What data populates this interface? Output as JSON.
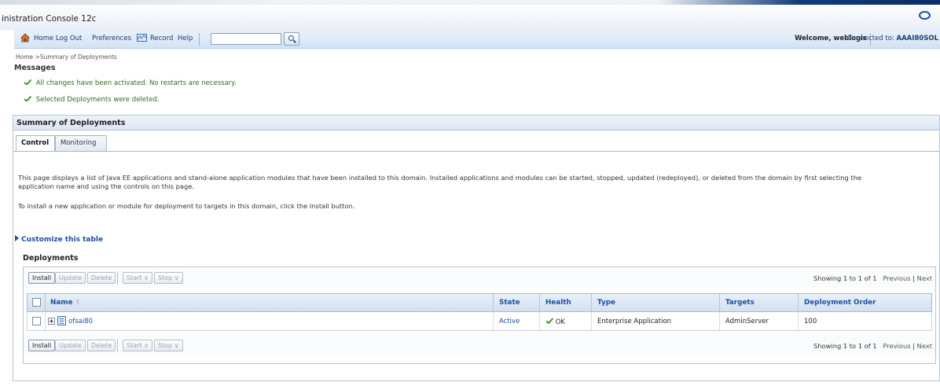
{
  "window": {
    "title": "inistration Console 12c"
  },
  "toolbar": {
    "home": "Home",
    "logout": "Log Out",
    "preferences": "Preferences",
    "record": "Record",
    "help": "Help",
    "search_value": "",
    "welcome": "Welcome, weblogic",
    "connected_prefix": "Connected to:",
    "connected_domain": "AAAI80SOL"
  },
  "breadcrumb": "Home >Summary of Deployments",
  "messages": {
    "label": "Messages",
    "items": [
      "All changes have been activated. No restarts are necessary.",
      "Selected Deployments were deleted."
    ]
  },
  "summary": {
    "title": "Summary of Deployments",
    "tabs": [
      "Control",
      "Monitoring"
    ],
    "description_1": "This page displays a list of Java EE applications and stand-alone application modules that have been installed to this domain. Installed applications and modules can be started, stopped, updated (redeployed), or deleted from the domain by first selecting the",
    "description_2": "application name and using the controls on this page.",
    "install_hint": "To install a new application or module for deployment to targets in this domain, click the Install button.",
    "customize": "Customize this table",
    "deployments_label": "Deployments"
  },
  "actions": {
    "install": "Install",
    "update": "Update",
    "delete": "Delete",
    "start": "Start ∨",
    "stop": "Stop ∨",
    "showing": "Showing 1 to 1 of 1",
    "previous": "Previous",
    "next": "Next"
  },
  "table": {
    "columns": [
      "Name",
      "State",
      "Health",
      "Type",
      "Targets",
      "Deployment Order"
    ],
    "rows": [
      {
        "name": "ofsai80",
        "state": "Active",
        "health": "OK",
        "type": "Enterprise Application",
        "targets": "AdminServer",
        "order": "100"
      }
    ]
  },
  "colors": {
    "accent_blue": "#1d4fa3",
    "ok_green": "#2c6e1e",
    "header_bg": "#d3e0ee"
  }
}
